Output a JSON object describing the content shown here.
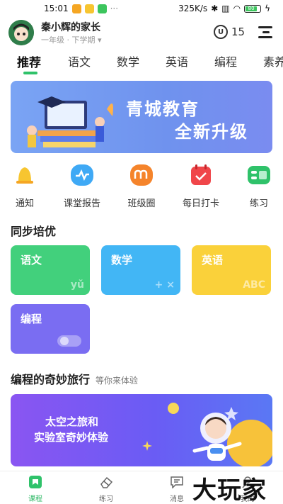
{
  "status_bar": {
    "time": "15:01",
    "network_speed": "325K/s",
    "battery": "80"
  },
  "header": {
    "user_name": "秦小辉的家长",
    "grade": "一年级 · 下学期 ▾",
    "coin_symbol": "U",
    "coin_count": "15"
  },
  "tabs": [
    {
      "label": "推荐"
    },
    {
      "label": "语文"
    },
    {
      "label": "数学"
    },
    {
      "label": "英语"
    },
    {
      "label": "编程"
    },
    {
      "label": "素养"
    }
  ],
  "banner": {
    "title": "青城教育",
    "subtitle": "全新升级"
  },
  "quick_links": [
    {
      "label": "通知",
      "icon": "bell-icon",
      "color": "#f7c530"
    },
    {
      "label": "课堂报告",
      "icon": "report-icon",
      "color": "#3fa9f5"
    },
    {
      "label": "班级圈",
      "icon": "class-circle-icon",
      "color": "#f5842b"
    },
    {
      "label": "每日打卡",
      "icon": "calendar-check-icon",
      "color": "#f0464a"
    },
    {
      "label": "练习",
      "icon": "practice-icon",
      "color": "#2fc26a"
    }
  ],
  "sync_section": {
    "title": "同步培优"
  },
  "subjects": [
    {
      "label": "语文",
      "deco": "yǔ",
      "color": "#42d07c"
    },
    {
      "label": "数学",
      "deco": "+ ×",
      "color": "#42b6f5"
    },
    {
      "label": "英语",
      "deco": "ABC",
      "color": "#fad13a"
    },
    {
      "label": "编程",
      "deco": "",
      "color": "#7a6df2"
    }
  ],
  "coding_section": {
    "title": "编程的奇妙旅行",
    "subtitle": "等你来体验",
    "line1": "太空之旅和",
    "line2": "实验室奇妙体验"
  },
  "bottom_nav": [
    {
      "label": "课程",
      "icon": "course-icon",
      "active": true
    },
    {
      "label": "练习",
      "icon": "eraser-icon",
      "active": false
    },
    {
      "label": "消息",
      "icon": "message-icon",
      "active": false
    },
    {
      "label": "我的",
      "icon": "profile-icon",
      "active": false
    }
  ],
  "watermark": "大玩家",
  "colors": {
    "accent": "#2fc26a",
    "banner": "#7aa4f4",
    "coding_banner": "#7b58f3"
  }
}
